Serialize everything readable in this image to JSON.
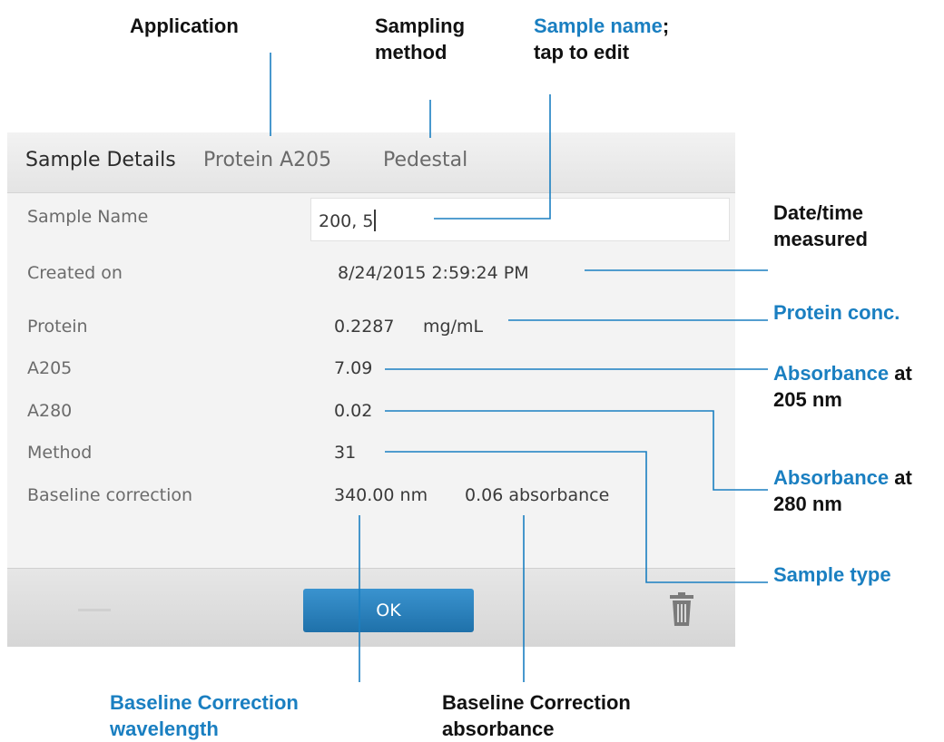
{
  "callouts": {
    "application": "Application",
    "sampling_method_1": "Sampling",
    "sampling_method_2": "method",
    "sample_name_hl": "Sample name",
    "sample_name_rest": ";",
    "sample_name_2": "tap to edit",
    "datetime_1": "Date/time",
    "datetime_2": "measured",
    "protein_conc": "Protein conc.",
    "abs205_hl": "Absorbance",
    "abs205_rest": " at",
    "abs205_2": "205 nm",
    "abs280_hl": "Absorbance",
    "abs280_rest": " at",
    "abs280_2": "280 nm",
    "sample_type": "Sample type",
    "bc_wavelength_1": "Baseline Correction",
    "bc_wavelength_2": "wavelength",
    "bc_absorbance_1": "Baseline Correction",
    "bc_absorbance_2": "absorbance"
  },
  "dialog": {
    "title": "Sample Details",
    "application": "Protein A205",
    "sampling_method": "Pedestal",
    "sample_name_label": "Sample Name",
    "sample_name_value": "200, 5",
    "rows": [
      {
        "label": "Created on",
        "value": "8/24/2015 2:59:24 PM"
      },
      {
        "label": "Protein",
        "value": "0.2287",
        "unit": "mg/mL"
      },
      {
        "label": "A205",
        "value": "7.09"
      },
      {
        "label": "A280",
        "value": "0.02"
      },
      {
        "label": "Method",
        "value": "31"
      },
      {
        "label": "Baseline correction",
        "value": "340.00 nm",
        "value2": "0.06 absorbance"
      }
    ],
    "ok_label": "OK",
    "trash_icon": "trash-icon"
  },
  "colors": {
    "highlight": "#1a7fc1",
    "button": "#2a83c0"
  }
}
